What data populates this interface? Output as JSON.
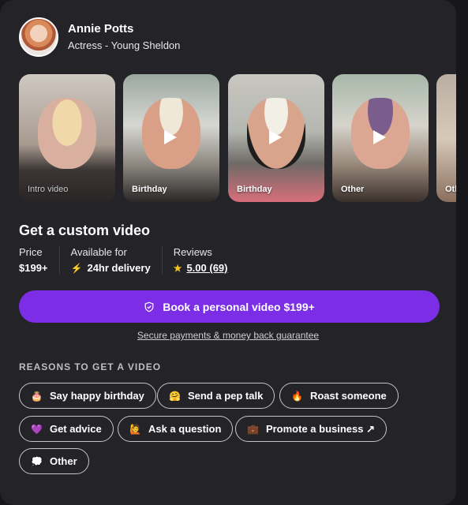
{
  "profile": {
    "name": "Annie Potts",
    "subtitle": "Actress - Young Sheldon"
  },
  "videos": [
    {
      "label": "Intro video",
      "icon": "none"
    },
    {
      "label": "Birthday",
      "icon": "play-icon"
    },
    {
      "label": "Birthday",
      "icon": "play-icon"
    },
    {
      "label": "Other",
      "icon": "play-icon"
    },
    {
      "label": "Oth",
      "icon": "none"
    }
  ],
  "offer": {
    "title": "Get a custom video",
    "price_label": "Price",
    "price_value": "$199+",
    "availability_label": "Available for",
    "availability_value": "24hr delivery",
    "reviews_label": "Reviews",
    "reviews_value": "5.00 (69)"
  },
  "book_button": "Book a personal video $199+",
  "secure_link": "Secure payments & money back guarantee",
  "reasons": {
    "heading": "REASONS TO GET A VIDEO",
    "chips": [
      {
        "emoji": "🎂",
        "label": "Say happy birthday"
      },
      {
        "emoji": "🤗",
        "label": "Send a pep talk"
      },
      {
        "emoji": "🔥",
        "label": "Roast someone"
      },
      {
        "emoji": "💜",
        "label": "Get advice"
      },
      {
        "emoji": "🙋",
        "label": "Ask a question"
      },
      {
        "emoji": "💼",
        "label": "Promote a business ↗"
      },
      {
        "emoji": "💭",
        "label": "Other"
      }
    ]
  },
  "colors": {
    "background": "#17161a",
    "card": "#242328",
    "accent": "#7b2ee6"
  }
}
